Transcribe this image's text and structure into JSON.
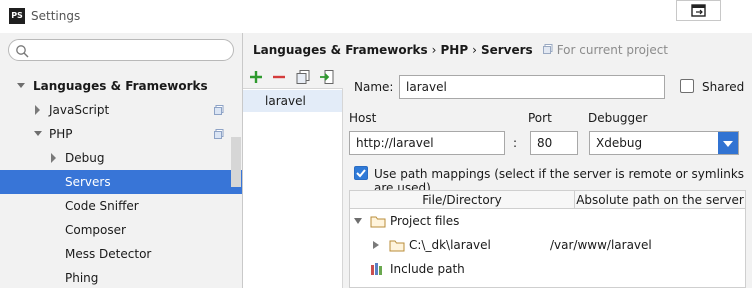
{
  "window": {
    "app_icon": "PS",
    "title": "Settings"
  },
  "sidebar": {
    "search_placeholder": "",
    "items": [
      {
        "label": "Languages & Frameworks",
        "expanded": true
      },
      {
        "label": "JavaScript",
        "expanded": false
      },
      {
        "label": "PHP",
        "expanded": true
      },
      {
        "label": "Debug",
        "expanded": false
      },
      {
        "label": "Servers",
        "selected": true
      },
      {
        "label": "Code Sniffer"
      },
      {
        "label": "Composer"
      },
      {
        "label": "Mess Detector"
      },
      {
        "label": "Phing"
      }
    ]
  },
  "breadcrumb": {
    "part1": "Languages & Frameworks",
    "sep": "›",
    "part2": "PHP",
    "part3": "Servers",
    "scope": "For current project"
  },
  "servers": {
    "items": [
      "laravel"
    ]
  },
  "form": {
    "name_label": "Name:",
    "name_value": "laravel",
    "shared_label": "Shared",
    "host_label": "Host",
    "host_value": "http://laravel",
    "colon": ":",
    "port_label": "Port",
    "port_value": "80",
    "debugger_label": "Debugger",
    "debugger_value": "Xdebug",
    "mappings_label": "Use path mappings (select if the server is remote or symlinks are used)"
  },
  "mappings": {
    "col1": "File/Directory",
    "col2": "Absolute path on the server",
    "project_files": "Project files",
    "dir_local": "C:\\_dk\\laravel",
    "dir_remote": "/var/www/laravel",
    "include_path": "Include path"
  },
  "colors": {
    "selection": "#3875d7",
    "checkbox": "#2f7ad8",
    "add": "#2e9a2e",
    "remove": "#d43c3c"
  }
}
